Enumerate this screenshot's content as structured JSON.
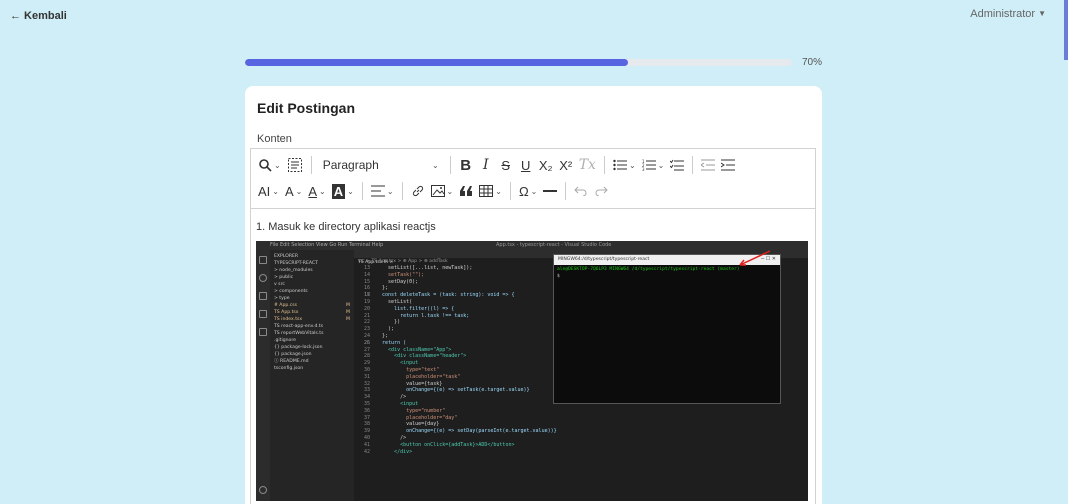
{
  "nav": {
    "back_label": "← Kembali",
    "user_label": "Administrator"
  },
  "progress": {
    "value": 0.7,
    "label": "70%"
  },
  "card": {
    "title": "Edit Postingan",
    "content_label": "Konten"
  },
  "toolbar": {
    "row1": {
      "find_icon": "find-replace-icon",
      "source_icon": "source-editing-icon",
      "heading_value": "Paragraph",
      "bold": "B",
      "italic": "I",
      "strike": "S",
      "underline": "U",
      "subscript": "X₂",
      "superscript": "X²",
      "remove_format": "Tx"
    },
    "row2": {
      "font_size": "AI",
      "font_family": "A",
      "font_color": "A",
      "highlight": "A",
      "special_chars": "Ω"
    }
  },
  "content": {
    "first_line": "1. Masuk ke directory aplikasi reactjs"
  },
  "screenshot": {
    "window_title": "App.tsx - typescript-react - Visual Studio Code",
    "menu": "File  Edit  Selection  View  Go  Run  Terminal  Help",
    "explorer_header": "EXPLORER",
    "files": [
      {
        "name": "TYPESCRIPT-REACT",
        "mod": ""
      },
      {
        "name": "> node_modules",
        "mod": ""
      },
      {
        "name": "> public",
        "mod": ""
      },
      {
        "name": "v src",
        "mod": ""
      },
      {
        "name": "> components",
        "mod": ""
      },
      {
        "name": "> type",
        "mod": ""
      },
      {
        "name": "# App.css",
        "mod": "M"
      },
      {
        "name": "TS App.tsx",
        "mod": "M"
      },
      {
        "name": "TS index.tsx",
        "mod": "M"
      },
      {
        "name": "TS react-app-env.d.ts",
        "mod": ""
      },
      {
        "name": "TS reportWebVitals.ts",
        "mod": ""
      },
      {
        "name": ".gitignore",
        "mod": ""
      },
      {
        "name": "{} package-lock.json",
        "mod": ""
      },
      {
        "name": "{} package.json",
        "mod": ""
      },
      {
        "name": "ⓘ README.md",
        "mod": ""
      },
      {
        "name": "tsconfig.json",
        "mod": ""
      }
    ],
    "tab": "TS App.tsx  M  ×",
    "breadcrumb": "src > TS App.tsx > ⊕ App > ⊕ addTask",
    "code": [
      {
        "n": "13",
        "t": "    setList([...list, newTask]);"
      },
      {
        "n": "14",
        "t": "    setTask(\"\");"
      },
      {
        "n": "15",
        "t": "    setDay(0);"
      },
      {
        "n": "16",
        "t": "  };"
      },
      {
        "n": "17",
        "t": ""
      },
      {
        "n": "18",
        "t": "  const deleteTask = (task: string): void => {"
      },
      {
        "n": "19",
        "t": "    setList("
      },
      {
        "n": "20",
        "t": "      list.filter((l) => {"
      },
      {
        "n": "21",
        "t": "        return l.task !== task;"
      },
      {
        "n": "22",
        "t": "      })"
      },
      {
        "n": "23",
        "t": "    );"
      },
      {
        "n": "24",
        "t": "  };"
      },
      {
        "n": "25",
        "t": ""
      },
      {
        "n": "26",
        "t": "  return ("
      },
      {
        "n": "27",
        "t": "    <div className=\"App\">"
      },
      {
        "n": "28",
        "t": "      <div className=\"header\">"
      },
      {
        "n": "29",
        "t": "        <input"
      },
      {
        "n": "30",
        "t": "          type=\"text\""
      },
      {
        "n": "31",
        "t": "          placeholder=\"task\""
      },
      {
        "n": "32",
        "t": "          value={task}"
      },
      {
        "n": "33",
        "t": "          onChange={(e) => setTask(e.target.value)}"
      },
      {
        "n": "34",
        "t": "        />"
      },
      {
        "n": "35",
        "t": "        <input"
      },
      {
        "n": "36",
        "t": "          type=\"number\""
      },
      {
        "n": "37",
        "t": "          placeholder=\"day\""
      },
      {
        "n": "38",
        "t": "          value={day}"
      },
      {
        "n": "39",
        "t": "          onChange={(e) => setDay(parseInt(e.target.value))}"
      },
      {
        "n": "40",
        "t": "        />"
      },
      {
        "n": "41",
        "t": "        <button onClick={addTask}>ADD</button>"
      },
      {
        "n": "42",
        "t": "      </div>"
      }
    ],
    "terminal_title": "MINGW64:/d/typescript/typescript-react",
    "terminal_prompt": "ale@DESKTOP-7Q6LP3 MINGW64 /d/typescript/typescript-react (master)",
    "terminal_cursor": "$"
  },
  "colors": {
    "page_bg": "#cfeef7",
    "accent": "#5765e0"
  }
}
